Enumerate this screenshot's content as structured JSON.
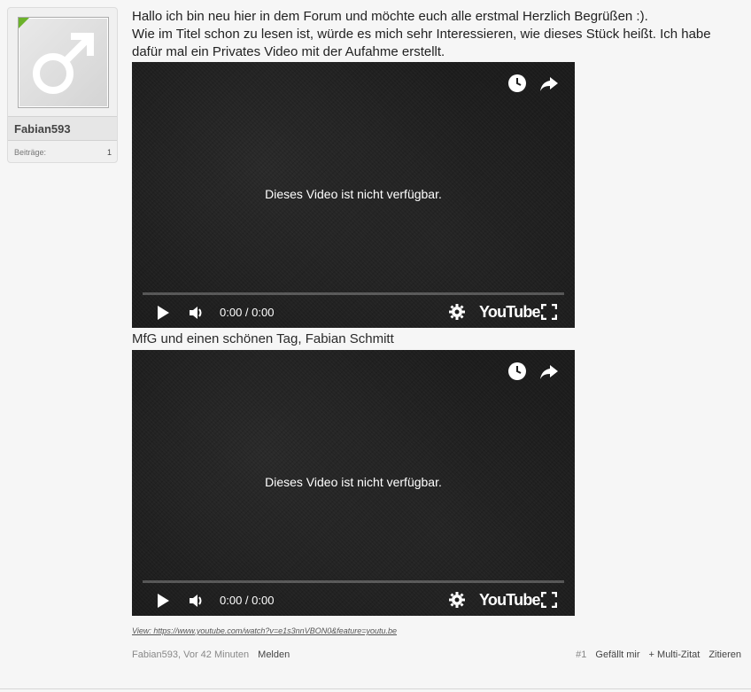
{
  "user": {
    "name": "Fabian593",
    "stats": {
      "label": "Beiträge:",
      "value": "1"
    }
  },
  "message": {
    "line1": "Hallo ich bin neu hier in dem Forum und möchte euch alle erstmal Herzlich Begrüßen :).",
    "line2": "Wie im Titel schon zu lesen ist, würde es mich sehr Interessieren, wie dieses Stück heißt. Ich habe",
    "line3": "dafür mal ein Privates Video mit der Aufahme erstellt.",
    "signature": "MfG und einen schönen Tag, Fabian Schmitt"
  },
  "videos": [
    {
      "unavailable_text": "Dieses Video ist nicht verfügbar.",
      "time": "0:00 / 0:00",
      "logo": "YouTube"
    },
    {
      "unavailable_text": "Dieses Video ist nicht verfügbar.",
      "time": "0:00 / 0:00",
      "logo": "YouTube"
    }
  ],
  "source_link": "View: https://www.youtube.com/watch?v=e1s3nnVBON0&feature=youtu.be",
  "footer": {
    "author_time": "Fabian593, Vor 42 Minuten",
    "report": "Melden",
    "post_number": "#1",
    "like": "Gefällt mir",
    "multi_quote": "+ Multi-Zitat",
    "quote": "Zitieren"
  },
  "colors": {
    "online": "#6bb22a",
    "video_bg": "#1c1c1c"
  }
}
